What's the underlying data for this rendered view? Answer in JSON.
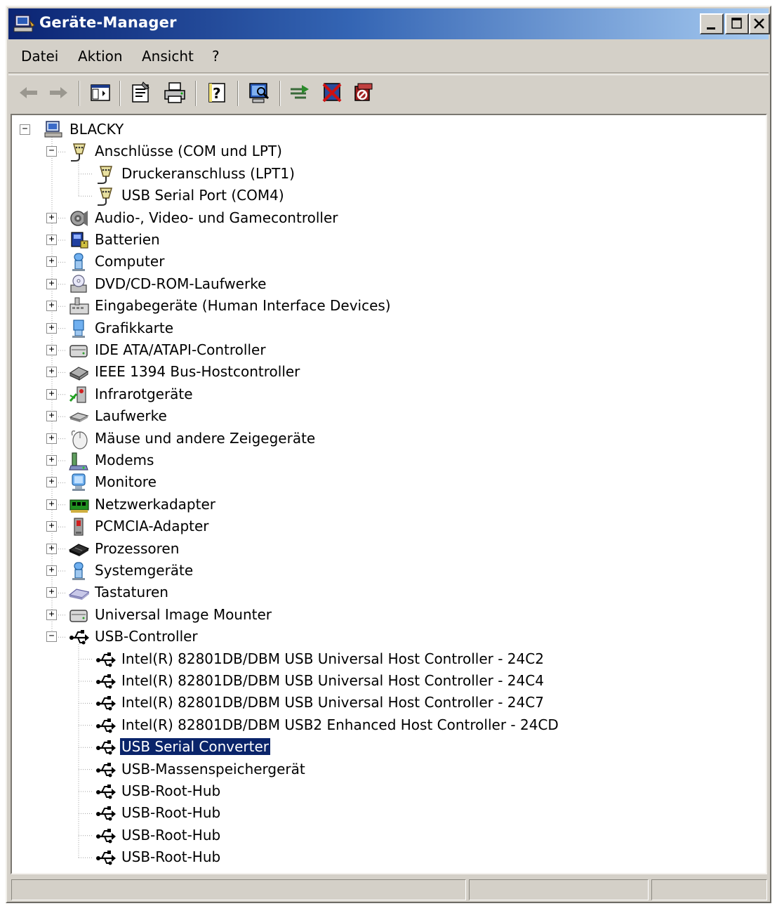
{
  "window": {
    "title": "Geräte-Manager",
    "title_icon": "computer-manage-icon",
    "caption_buttons": [
      "minimize",
      "maximize",
      "close"
    ]
  },
  "menu": [
    "Datei",
    "Aktion",
    "Ansicht",
    "?"
  ],
  "toolbar": [
    {
      "name": "back-icon"
    },
    {
      "name": "forward-icon"
    },
    {
      "name": "show-hide-console-tree-icon"
    },
    {
      "name": "properties-icon"
    },
    {
      "name": "print-icon"
    },
    {
      "name": "help-icon"
    },
    {
      "name": "scan-hardware-icon"
    },
    {
      "name": "update-driver-icon"
    },
    {
      "name": "uninstall-icon"
    },
    {
      "name": "disable-icon"
    }
  ],
  "tree": {
    "root": {
      "label": "BLACKY",
      "icon": "computer-icon",
      "expanded": true
    },
    "items": [
      {
        "label": "Anschlüsse (COM und LPT)",
        "icon": "port-icon",
        "expanded": true,
        "children": [
          {
            "label": "Druckeranschluss (LPT1)",
            "icon": "port-icon"
          },
          {
            "label": "USB Serial Port (COM4)",
            "icon": "port-icon"
          }
        ]
      },
      {
        "label": "Audio-, Video- und Gamecontroller",
        "icon": "audio-icon",
        "expanded": false
      },
      {
        "label": "Batterien",
        "icon": "battery-icon",
        "expanded": false
      },
      {
        "label": "Computer",
        "icon": "computer-monitor-icon",
        "expanded": false
      },
      {
        "label": "DVD/CD-ROM-Laufwerke",
        "icon": "cdrom-icon",
        "expanded": false
      },
      {
        "label": "Eingabegeräte (Human Interface Devices)",
        "icon": "hid-icon",
        "expanded": false
      },
      {
        "label": "Grafikkarte",
        "icon": "display-adapter-icon",
        "expanded": false
      },
      {
        "label": "IDE ATA/ATAPI-Controller",
        "icon": "ide-icon",
        "expanded": false
      },
      {
        "label": "IEEE 1394 Bus-Hostcontroller",
        "icon": "firewire-icon",
        "expanded": false
      },
      {
        "label": "Infrarotgeräte",
        "icon": "infrared-icon",
        "expanded": false
      },
      {
        "label": "Laufwerke",
        "icon": "disk-drive-icon",
        "expanded": false
      },
      {
        "label": "Mäuse und andere Zeigegeräte",
        "icon": "mouse-icon",
        "expanded": false
      },
      {
        "label": "Modems",
        "icon": "modem-icon",
        "expanded": false
      },
      {
        "label": "Monitore",
        "icon": "monitor-icon",
        "expanded": false
      },
      {
        "label": "Netzwerkadapter",
        "icon": "network-adapter-icon",
        "expanded": false
      },
      {
        "label": "PCMCIA-Adapter",
        "icon": "pcmcia-icon",
        "expanded": false
      },
      {
        "label": "Prozessoren",
        "icon": "processor-icon",
        "expanded": false
      },
      {
        "label": "Systemgeräte",
        "icon": "system-device-icon",
        "expanded": false
      },
      {
        "label": "Tastaturen",
        "icon": "keyboard-icon",
        "expanded": false
      },
      {
        "label": "Universal Image Mounter",
        "icon": "ide-icon",
        "expanded": false
      },
      {
        "label": "USB-Controller",
        "icon": "usb-icon",
        "expanded": true,
        "children": [
          {
            "label": "Intel(R) 82801DB/DBM USB Universal Host Controller - 24C2",
            "icon": "usb-icon"
          },
          {
            "label": "Intel(R) 82801DB/DBM USB Universal Host Controller - 24C4",
            "icon": "usb-icon"
          },
          {
            "label": "Intel(R) 82801DB/DBM USB Universal Host Controller - 24C7",
            "icon": "usb-icon"
          },
          {
            "label": "Intel(R) 82801DB/DBM USB2 Enhanced Host Controller - 24CD",
            "icon": "usb-icon"
          },
          {
            "label": "USB Serial Converter",
            "icon": "usb-icon",
            "selected": true
          },
          {
            "label": "USB-Massenspeichergerät",
            "icon": "usb-icon"
          },
          {
            "label": "USB-Root-Hub",
            "icon": "usb-icon"
          },
          {
            "label": "USB-Root-Hub",
            "icon": "usb-icon"
          },
          {
            "label": "USB-Root-Hub",
            "icon": "usb-icon"
          },
          {
            "label": "USB-Root-Hub",
            "icon": "usb-icon"
          }
        ]
      }
    ]
  },
  "colors": {
    "selection": "#0a246a",
    "title_start": "#0b2473",
    "title_end": "#a6caf0",
    "face": "#d4d0c8"
  }
}
